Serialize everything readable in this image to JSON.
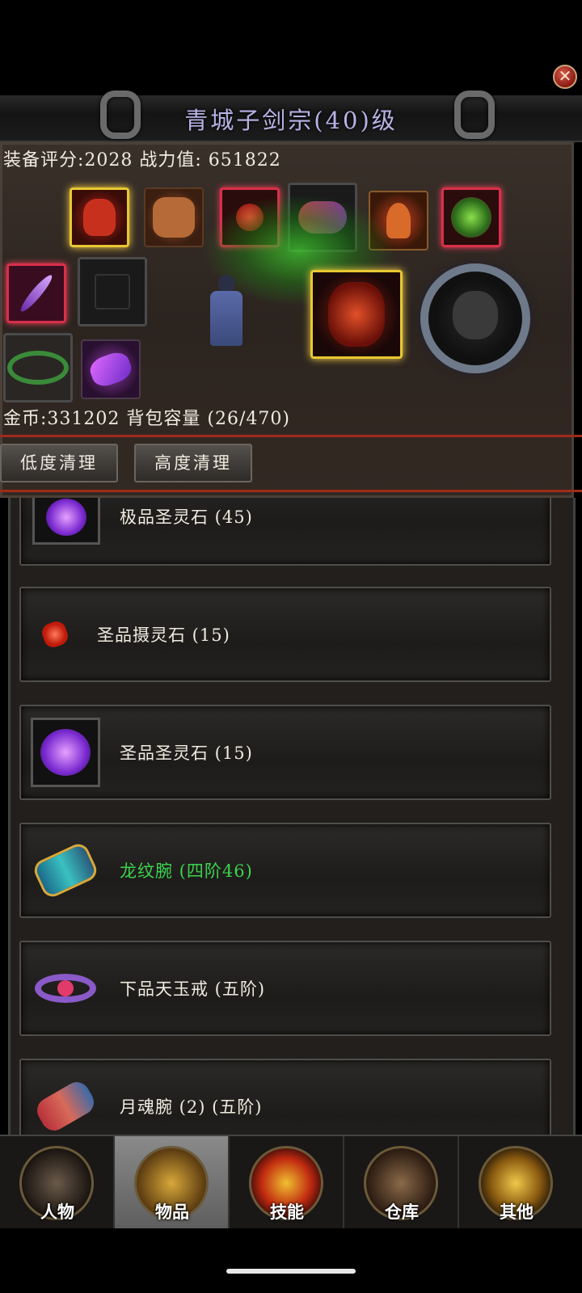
{
  "header": {
    "title": "青城子剑宗(40)级",
    "close_symbol": "✕"
  },
  "stats": {
    "score_line": "装备评分:2028 战力值: 651822",
    "gold_line": "金币:331202 背包容量 (26/470)"
  },
  "actions": {
    "low_clean": "低度清理",
    "high_clean": "高度清理"
  },
  "items": [
    {
      "label": "极品圣灵石 (45)",
      "icon": "purple-spirit-stone-icon"
    },
    {
      "label": "圣品摄灵石 (15)",
      "icon": "red-spirit-stone-icon"
    },
    {
      "label": "圣品圣灵石 (15)",
      "icon": "purple-spirit-stone-icon"
    },
    {
      "label": "龙纹腕 (四阶46)",
      "icon": "bracer-icon",
      "color": "#3bd34e"
    },
    {
      "label": "下品天玉戒 (五阶)",
      "icon": "ring-icon"
    },
    {
      "label": "月魂腕 (2) (五阶)",
      "icon": "bracer-icon"
    }
  ],
  "nav": {
    "tabs": [
      {
        "label": "人物",
        "icon": "character-icon"
      },
      {
        "label": "物品",
        "icon": "items-icon",
        "active": true
      },
      {
        "label": "技能",
        "icon": "skills-icon"
      },
      {
        "label": "仓库",
        "icon": "warehouse-icon"
      },
      {
        "label": "其他",
        "icon": "trophy-icon"
      }
    ]
  }
}
